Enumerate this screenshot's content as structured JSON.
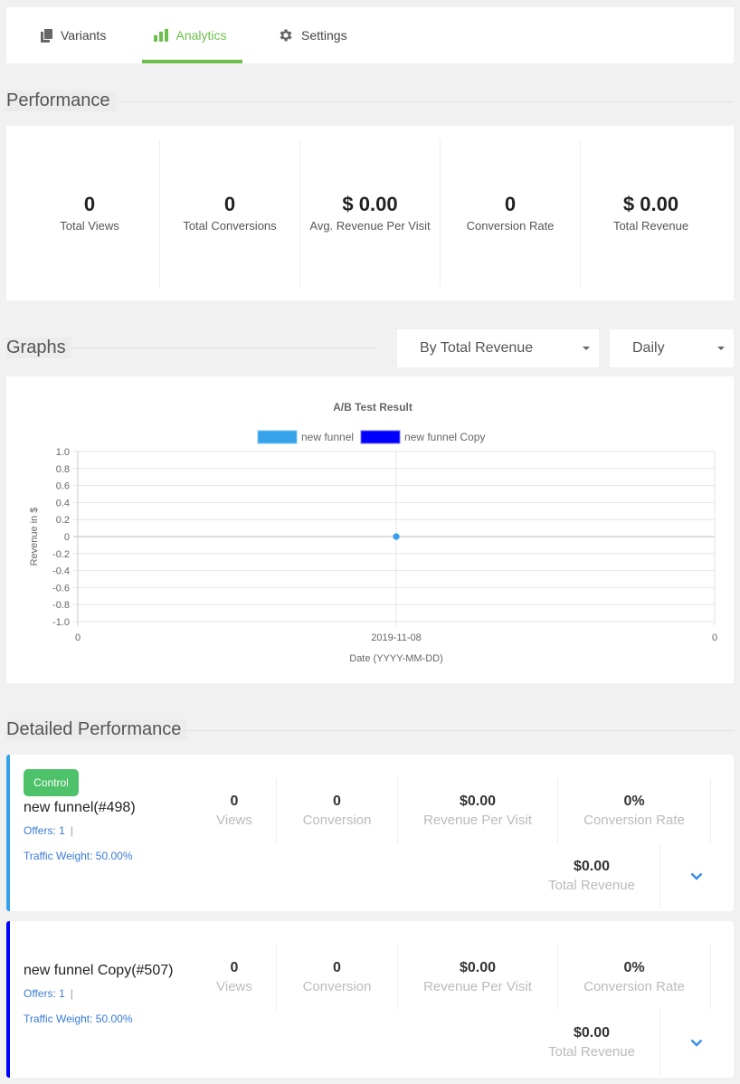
{
  "tabs": [
    {
      "label": "Variants",
      "icon": "copy-icon",
      "active": false
    },
    {
      "label": "Analytics",
      "icon": "bar-chart-icon",
      "active": true
    },
    {
      "label": "Settings",
      "icon": "gear-icon",
      "active": false
    }
  ],
  "colors": {
    "accent": "#6cbf4a",
    "variant_a": "#36a2eb",
    "variant_b": "#0000ff",
    "link": "#3a7bd5",
    "badge": "#4ec26a"
  },
  "performance": {
    "title": "Performance",
    "stats": [
      {
        "value": "0",
        "label": "Total Views"
      },
      {
        "value": "0",
        "label": "Total Conversions"
      },
      {
        "value": "$ 0.00",
        "label": "Avg. Revenue Per Visit"
      },
      {
        "value": "0",
        "label": "Conversion Rate"
      },
      {
        "value": "$ 0.00",
        "label": "Total Revenue"
      }
    ]
  },
  "graphs": {
    "title": "Graphs",
    "metric_select": {
      "value": "By Total Revenue"
    },
    "period_select": {
      "value": "Daily"
    }
  },
  "chart_data": {
    "type": "line",
    "title": "A/B Test Result",
    "xlabel": "Date (YYYY-MM-DD)",
    "ylabel": "Revenue in $",
    "ylim": [
      -1.0,
      1.0
    ],
    "yticks": [
      "1.0",
      "0.8",
      "0.6",
      "0.4",
      "0.2",
      "0",
      "-0.2",
      "-0.4",
      "-0.6",
      "-0.8",
      "-1.0"
    ],
    "xtick_labels": [
      "0",
      "2019-11-08",
      "0"
    ],
    "categories": [
      "2019-11-08"
    ],
    "series": [
      {
        "name": "new funnel",
        "color": "#36a2eb",
        "values": [
          0
        ]
      },
      {
        "name": "new funnel Copy",
        "color": "#0000ff",
        "values": [
          0
        ]
      }
    ],
    "grid": true,
    "legend": "top-center"
  },
  "detailed": {
    "title": "Detailed Performance",
    "variants": [
      {
        "badge": "Control",
        "name": "new funnel(#498)",
        "offers": "Offers: 1",
        "separator": "|",
        "traffic": "Traffic Weight: 50.00%",
        "color": "#36a2eb",
        "stats": [
          {
            "value": "0",
            "label": "Views"
          },
          {
            "value": "0",
            "label": "Conversion"
          },
          {
            "value": "$0.00",
            "label": "Revenue Per Visit"
          },
          {
            "value": "0%",
            "label": "Conversion Rate"
          }
        ],
        "total": {
          "value": "$0.00",
          "label": "Total Revenue"
        }
      },
      {
        "badge": "",
        "name": "new funnel Copy(#507)",
        "offers": "Offers: 1",
        "separator": "|",
        "traffic": "Traffic Weight: 50.00%",
        "color": "#0000ff",
        "stats": [
          {
            "value": "0",
            "label": "Views"
          },
          {
            "value": "0",
            "label": "Conversion"
          },
          {
            "value": "$0.00",
            "label": "Revenue Per Visit"
          },
          {
            "value": "0%",
            "label": "Conversion Rate"
          }
        ],
        "total": {
          "value": "$0.00",
          "label": "Total Revenue"
        }
      }
    ]
  }
}
